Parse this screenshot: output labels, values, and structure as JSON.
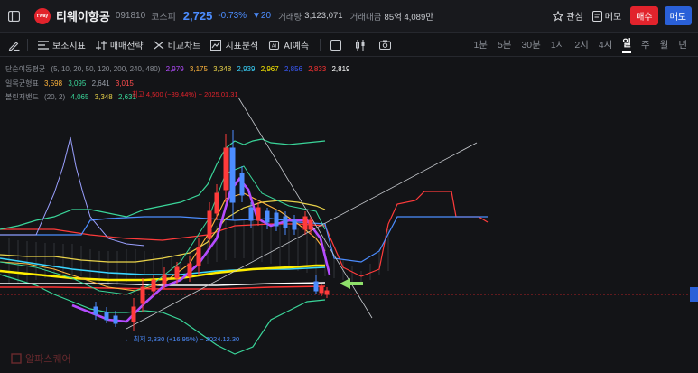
{
  "header": {
    "stock_name": "티웨이항공",
    "stock_code": "091810",
    "market": "코스피",
    "price": "2,725",
    "change_pct": "-0.73%",
    "change_abs": "▼20",
    "volume_label": "거래량",
    "volume_value": "3,123,071",
    "amount_label": "거래대금",
    "amount_value": "85억 4,089만",
    "interest_label": "관심",
    "memo_label": "메모",
    "buy_label": "매수",
    "sell_label": "매도",
    "logo_text": "t'way"
  },
  "toolbar": {
    "tools": [
      "보조지표",
      "매매전략",
      "비교차트",
      "지표분석",
      "AI예측"
    ],
    "periods": [
      "1분",
      "5분",
      "30분",
      "1시",
      "2시",
      "4시",
      "일",
      "주",
      "월",
      "년"
    ],
    "active_period": "일"
  },
  "legend": {
    "ma": {
      "name": "단순이동평균",
      "params": "(5, 10, 20, 50, 120, 200, 240, 480)",
      "values": [
        "2,979",
        "3,175",
        "3,348",
        "2,939",
        "2,967",
        "2,856",
        "2,833",
        "2,819"
      ],
      "colors": [
        "#b44cff",
        "#ffb53d",
        "#e8d24a",
        "#3ad6ff",
        "#ffee00",
        "#3b5bff",
        "#ff3333",
        "#ffffff"
      ]
    },
    "ichimoku": {
      "name": "일목균형표",
      "values": [
        "3,598",
        "3,095",
        "2,641",
        "3,015"
      ],
      "colors": [
        "#ffb53d",
        "#3ad69a",
        "#9aa0aa",
        "#ff4d4d"
      ]
    },
    "bollinger": {
      "name": "볼린저밴드",
      "params": "(20, 2)",
      "values": [
        "4,065",
        "3,348",
        "2,631"
      ],
      "colors": [
        "#3ad69a",
        "#e8d24a",
        "#3ad69a"
      ]
    }
  },
  "annotations": {
    "high": "최고 4,500 (−39.44%) − 2025.01.31",
    "low": "← 최저 2,330 (+16.95%) − 2024.12.30"
  },
  "watermark": "알파스퀘어"
}
